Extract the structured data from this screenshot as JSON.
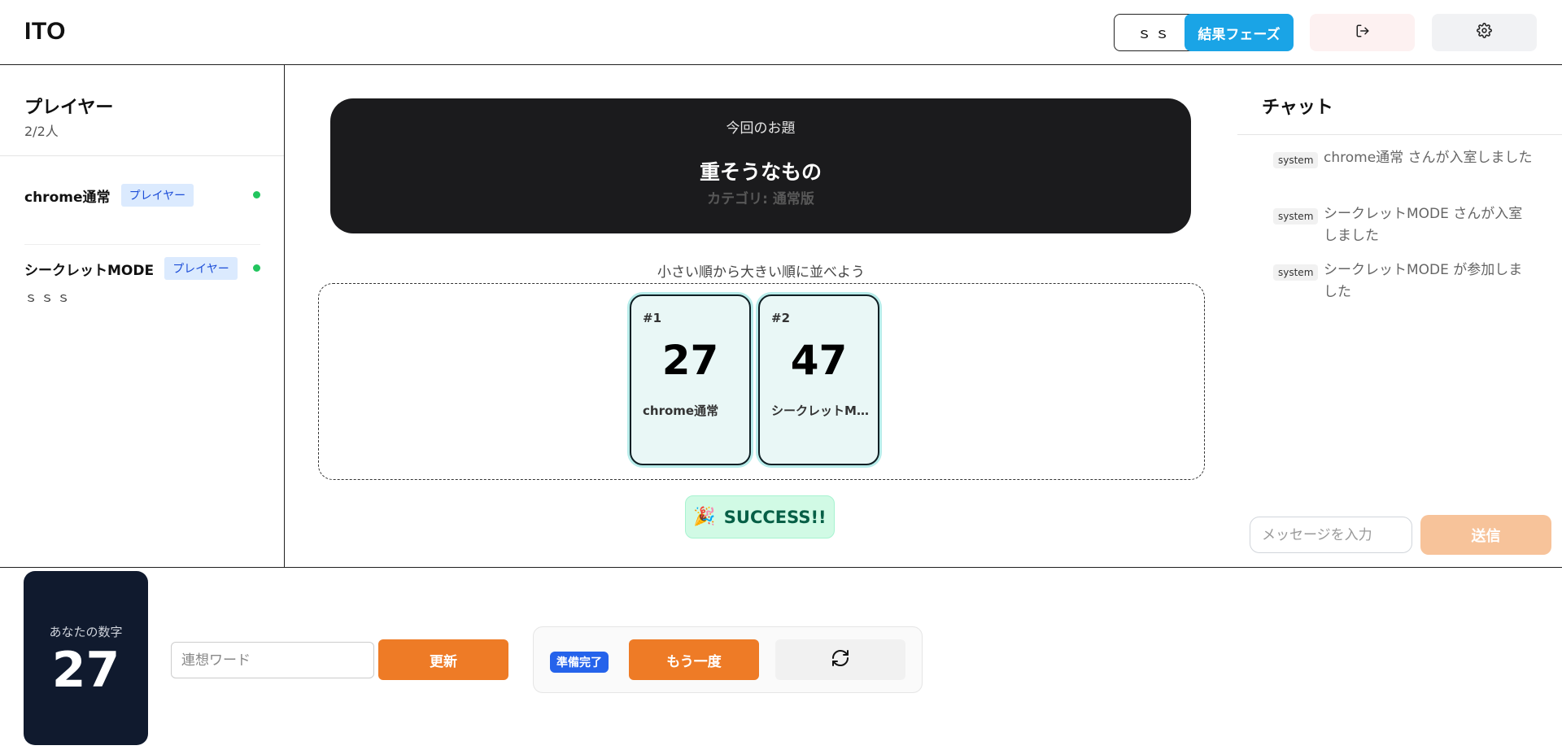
{
  "header": {
    "logo": "ITO",
    "user_button": "ｓｓ",
    "phase_button": "結果フェーズ",
    "exit_icon": "logout-icon",
    "settings_icon": "gear-icon"
  },
  "players": {
    "title": "プレイヤー",
    "count": "2/2人",
    "list": [
      {
        "name": "chrome通常",
        "role": "プレイヤー",
        "online": true,
        "hint": ""
      },
      {
        "name": "シークレットMODE",
        "role": "プレイヤー",
        "online": true,
        "hint": "ｓｓｓ"
      }
    ]
  },
  "topic": {
    "label": "今回のお題",
    "title": "重そうなもの",
    "category": "カテゴリ: 通常版"
  },
  "board": {
    "instruction": "小さい順から大きい順に並べよう",
    "cards": [
      {
        "rank": "#1",
        "number": "27",
        "player": "chrome通常"
      },
      {
        "rank": "#2",
        "number": "47",
        "player": "シークレットMODE"
      }
    ],
    "result": "SUCCESS!!",
    "result_icon": "party-popper-icon"
  },
  "chat": {
    "title": "チャット",
    "messages": [
      {
        "tag": "system",
        "text": "chrome通常 さんが入室しました"
      },
      {
        "tag": "system",
        "text": "シークレットMODE さんが入室しました"
      },
      {
        "tag": "system",
        "text": "シークレットMODE が参加しました"
      }
    ],
    "input_placeholder": "メッセージを入力",
    "send_label": "送信"
  },
  "bottom": {
    "my_number_label": "あなたの数字",
    "my_number": "27",
    "association_placeholder": "連想ワード",
    "update_label": "更新",
    "ready_badge": "準備完了",
    "again_label": "もう一度",
    "refresh_icon": "refresh-icon"
  },
  "colors": {
    "primary_orange": "#ee7b26",
    "phase_blue": "#1aa4e6",
    "ready_blue": "#2563eb",
    "success_green": "#065f46",
    "dark_card": "#101a2e",
    "online_green": "#22c55e"
  }
}
